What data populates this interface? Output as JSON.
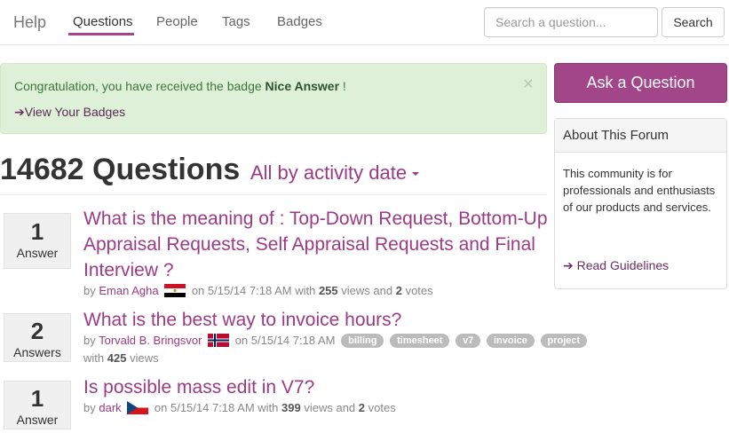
{
  "nav": {
    "brand": "Help",
    "items": [
      {
        "label": "Questions",
        "active": true
      },
      {
        "label": "People",
        "active": false
      },
      {
        "label": "Tags",
        "active": false
      },
      {
        "label": "Badges",
        "active": false
      }
    ],
    "search_placeholder": "Search a question...",
    "search_button": "Search"
  },
  "alert": {
    "text_prefix": "Congratulation, you have received the badge ",
    "badge_name": "Nice Answer",
    "text_suffix": " !",
    "close": "×",
    "link_arrow": "➔",
    "link_label": "View Your Badges"
  },
  "heading": {
    "count_title": "14682 Questions",
    "sort_label": "All by activity date"
  },
  "questions": [
    {
      "answers": "1",
      "answers_label": "Answer",
      "title": "What is the meaning of : Top-Down Request, Bottom-Up Appraisal Requests, Self Appraisal Requests and Final Interview ?",
      "by": "by",
      "author": "Eman Agha",
      "flag": "egypt-flag-icon",
      "on": "on 5/15/14 7:18 AM with",
      "views": "255",
      "views_word": "views and",
      "votes": "2",
      "votes_word": "votes",
      "tags": []
    },
    {
      "answers": "2",
      "answers_label": "Answers",
      "title": "What is the best way to invoice hours?",
      "by": "by",
      "author": "Torvald B. Bringsvor",
      "flag": "norway-flag-icon",
      "on": "on 5/15/14 7:18 AM",
      "tags": [
        "billing",
        "timesheet",
        "v7",
        "invoice",
        "project"
      ],
      "with_word": "with",
      "views": "425",
      "views_word": "views"
    },
    {
      "answers": "1",
      "answers_label": "Answer",
      "title": "Is possible mass edit in V7?",
      "by": "by",
      "author": "dark",
      "flag": "czech-flag-icon",
      "on": "on 5/15/14 7:18 AM with",
      "views": "399",
      "views_word": "views and",
      "votes": "2",
      "votes_word": "votes",
      "tags": []
    }
  ],
  "sidebar": {
    "ask_button": "Ask a Question",
    "panel_title": "About This Forum",
    "panel_text": "This community is for professionals and enthusiasts of our products and services.",
    "link_arrow": "➔",
    "link_label": "Read Guidelines"
  },
  "colors": {
    "accent": "#a24689",
    "link": "#9c3a86",
    "alert_bg": "#dff0d8",
    "alert_text": "#3c763d",
    "tag_bg": "#bbbbbb"
  }
}
